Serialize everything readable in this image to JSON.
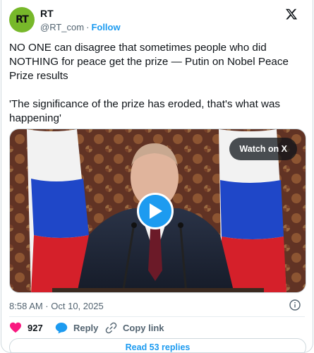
{
  "account": {
    "avatar_text": "RT",
    "display_name": "RT",
    "handle": "@RT_com",
    "separator": "·",
    "follow_label": "Follow"
  },
  "icons": {
    "brand": "x-logo-icon",
    "info": "info-icon",
    "like": "heart-icon",
    "reply": "reply-bubble-icon",
    "copy": "link-icon",
    "play": "play-icon"
  },
  "colors": {
    "accent": "#1d9bf0",
    "like": "#f91880",
    "avatar_bg": "#77b82a",
    "muted": "#536471"
  },
  "tweet": {
    "paragraph_1": "NO ONE can disagree that sometimes people who did NOTHING for peace get the prize — Putin on Nobel Peace Prize results",
    "paragraph_2": "'The significance of the prize has eroded, that's what was happening'"
  },
  "media": {
    "watch_label": "Watch on X"
  },
  "meta": {
    "timestamp": "8:58 AM · Oct 10, 2025"
  },
  "actions": {
    "like_count": "927",
    "reply_label": "Reply",
    "copy_label": "Copy link"
  },
  "footer": {
    "read_replies_label": "Read 53 replies"
  }
}
